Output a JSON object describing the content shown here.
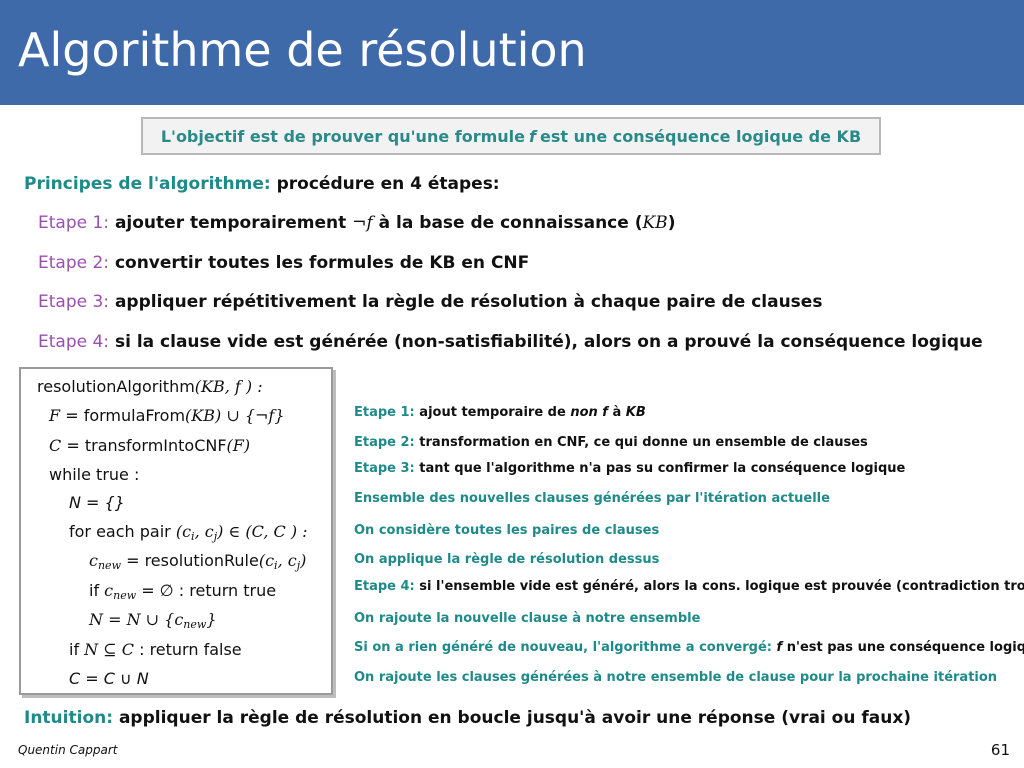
{
  "title": "Algorithme de résolution",
  "objective": {
    "before": "L'objectif est de prouver qu'une formule",
    "var": "f",
    "after": "est une conséquence logique de KB"
  },
  "principles": {
    "label": "Principes de l'algorithme:",
    "text": "procédure en 4 étapes:"
  },
  "steps": [
    {
      "label": "Etape 1:",
      "text_a": "ajouter temporairement",
      "math_a": "¬f",
      "text_b": "à la base de connaissance (",
      "math_b": "KB",
      "text_c": ")"
    },
    {
      "label": "Etape 2:",
      "text": "convertir toutes les formules de KB en CNF"
    },
    {
      "label": "Etape 3:",
      "text": "appliquer répétitivement la règle de résolution à chaque paire de clauses"
    },
    {
      "label": "Etape 4:",
      "text": "si la clause vide est générée (non-satisfiabilité), alors on a prouvé la conséquence logique"
    }
  ],
  "algorithm": {
    "l0_fn": "resolutionAlgorithm",
    "l0_args": "(KB, f ) :",
    "l1_lhs": "F",
    "l1_eq": "=",
    "l1_fn": "formulaFrom",
    "l1_args": "(KB) ∪ {¬f}",
    "l2_lhs": "C",
    "l2_eq": "=",
    "l2_fn": "transformIntoCNF",
    "l2_args": "(F)",
    "l3": "while true :",
    "l4": "N = {}",
    "l5_text": "for each pair",
    "l5_math": "(c",
    "l5_i": "i",
    "l5_mid": ", c",
    "l5_j": "j",
    "l5_end": ") ∈ (C, C ) :",
    "l6_c": "c",
    "l6_new": "new",
    "l6_eq": " = ",
    "l6_fn": "resolutionRule",
    "l6_args_a": "(c",
    "l6_i": "i",
    "l6_args_b": ", c",
    "l6_j": "j",
    "l6_args_c": ")",
    "l7_if": "if",
    "l7_c": "c",
    "l7_new": "new",
    "l7_rest": " = ∅",
    "l7_ret": ": return true",
    "l8_a": "N = N ∪ {c",
    "l8_new": "new",
    "l8_b": "}",
    "l9_if": "if",
    "l9_math": "N ⊆ C",
    "l9_ret": ": return false",
    "l10": "C = C ∪ N"
  },
  "notes": [
    {
      "label": "Etape 1:",
      "text_a": "ajout temporaire de",
      "em": "non f",
      "text_b": "à",
      "em2": "KB"
    },
    {
      "label": "Etape 2:",
      "text": "transformation en CNF, ce qui donne un ensemble de clauses"
    },
    {
      "label": "Etape 3:",
      "text": "tant que l'algorithme n'a pas su confirmer la conséquence logique"
    },
    {
      "text": "Ensemble des nouvelles clauses générées par l'itération actuelle"
    },
    {
      "text": "On considère toutes les paires de clauses"
    },
    {
      "text": "On applique la règle de résolution dessus"
    },
    {
      "label": "Etape 4:",
      "text": "si l'ensemble vide est généré, alors la cons. logique est prouvée (contradiction trouvée)"
    },
    {
      "text": "On rajoute la nouvelle clause à notre ensemble"
    },
    {
      "text_a": "Si on a rien généré de nouveau, l'algorithme a convergé:",
      "em": "f",
      "text_b": "n'est pas une conséquence logique"
    },
    {
      "text": "On rajoute les clauses générées à notre ensemble de clause pour la prochaine itération"
    }
  ],
  "intuition": {
    "label": "Intuition:",
    "text": "appliquer la règle de résolution en boucle jusqu'à avoir une réponse (vrai ou faux)"
  },
  "footer": {
    "author": "Quentin Cappart",
    "page": "61"
  }
}
